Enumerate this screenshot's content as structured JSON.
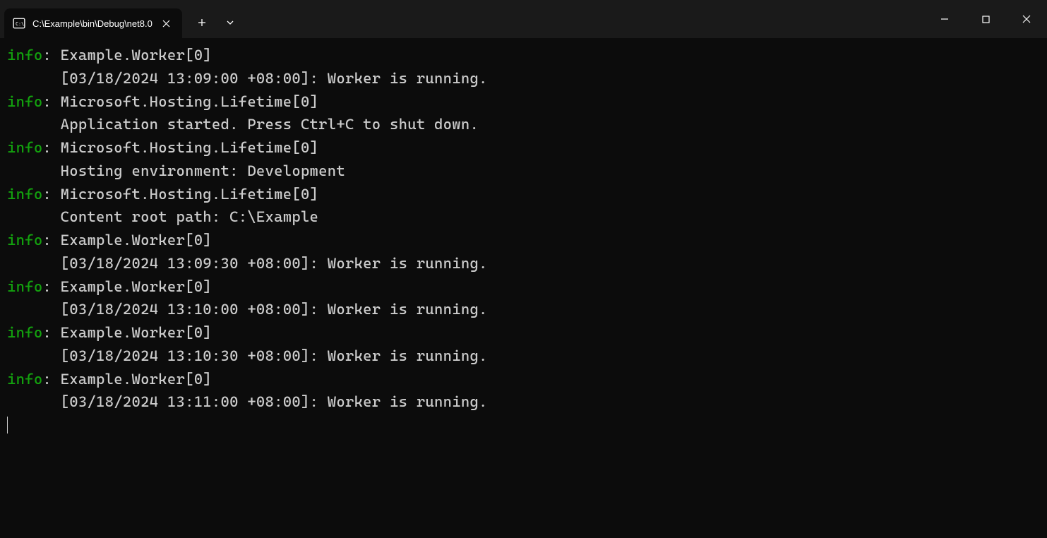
{
  "window": {
    "tab_title": "C:\\Example\\bin\\Debug\\net8.0"
  },
  "colors": {
    "info_level": "#13a10e",
    "text": "#cccccc",
    "background": "#0c0c0c"
  },
  "log_entries": [
    {
      "level": "info",
      "source": "Example.Worker[0]",
      "message": "[03/18/2024 13:09:00 +08:00]: Worker is running."
    },
    {
      "level": "info",
      "source": "Microsoft.Hosting.Lifetime[0]",
      "message": "Application started. Press Ctrl+C to shut down."
    },
    {
      "level": "info",
      "source": "Microsoft.Hosting.Lifetime[0]",
      "message": "Hosting environment: Development"
    },
    {
      "level": "info",
      "source": "Microsoft.Hosting.Lifetime[0]",
      "message": "Content root path: C:\\Example"
    },
    {
      "level": "info",
      "source": "Example.Worker[0]",
      "message": "[03/18/2024 13:09:30 +08:00]: Worker is running."
    },
    {
      "level": "info",
      "source": "Example.Worker[0]",
      "message": "[03/18/2024 13:10:00 +08:00]: Worker is running."
    },
    {
      "level": "info",
      "source": "Example.Worker[0]",
      "message": "[03/18/2024 13:10:30 +08:00]: Worker is running."
    },
    {
      "level": "info",
      "source": "Example.Worker[0]",
      "message": "[03/18/2024 13:11:00 +08:00]: Worker is running."
    }
  ]
}
